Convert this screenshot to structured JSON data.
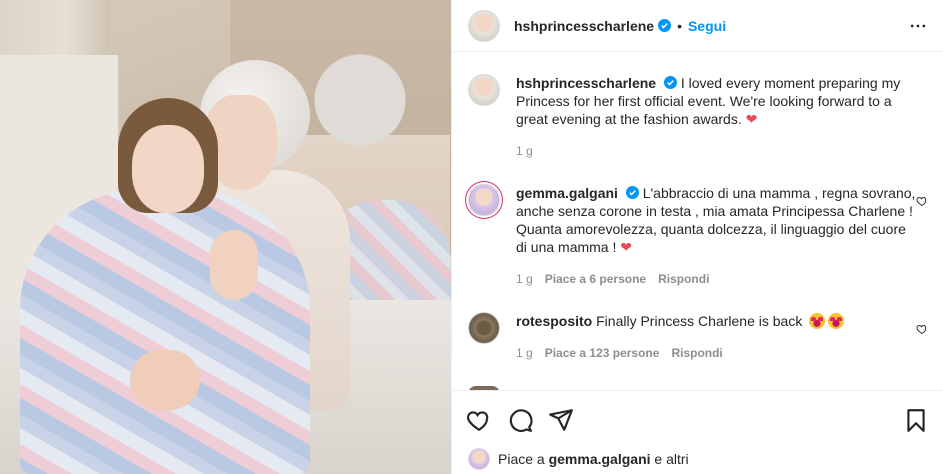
{
  "post": {
    "author": "hshprincesscharlene",
    "follow_label": "Segui",
    "dot": "•",
    "caption": "I loved every moment preparing my Princess for her first official event. We're looking forward to a great evening at the fashion awards.",
    "caption_heart": "❤",
    "caption_time": "1 g"
  },
  "comments": [
    {
      "username": "gemma.galgani",
      "text": "L'abbraccio di una mamma , regna sovrano, anche senza corone in testa , mia amata Principessa Charlene ! Quanta amorevolezza, quanta dolcezza, il linguaggio del cuore di una mamma !",
      "heart": "❤",
      "time": "1 g",
      "likes": "Piace a 6 persone",
      "reply": "Rispondi"
    },
    {
      "username": "rotesposito",
      "text": "Finally Princess Charlene is back",
      "time": "1 g",
      "likes": "Piace a 123 persone",
      "reply": "Rispondi"
    }
  ],
  "likes_bar": {
    "prefix": "Piace a",
    "user": "gemma.galgani",
    "suffix": "e altri"
  },
  "icons": [
    "more-options-icon",
    "verified-badge-icon",
    "heart-icon",
    "comment-icon",
    "share-icon",
    "bookmark-icon",
    "heart-eyes-emoji"
  ],
  "colors": {
    "accent": "#0095f6",
    "heart": "#ed4956",
    "text": "#262626",
    "muted": "#8e8e8e"
  }
}
